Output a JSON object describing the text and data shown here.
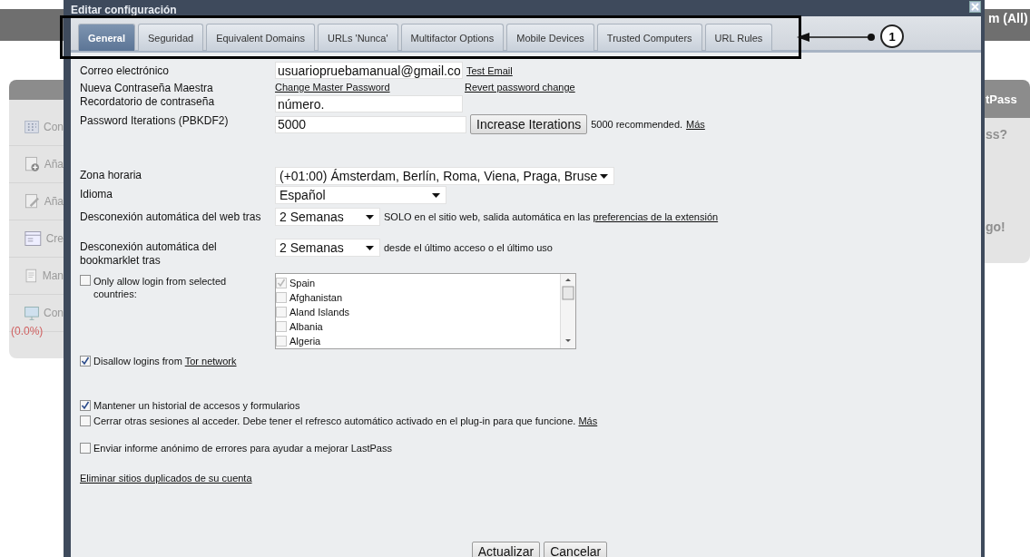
{
  "background": {
    "header_text": "m (All)",
    "sidebar_items": [
      {
        "label": "Con",
        "kind": "grid"
      },
      {
        "label": "Aña",
        "kind": "add"
      },
      {
        "label": "Aña",
        "kind": "edit"
      },
      {
        "label": "Cre",
        "kind": "form"
      },
      {
        "label": "Man",
        "kind": "doc"
      },
      {
        "label": "Con",
        "kind": "screen"
      }
    ],
    "percent": "(0.0%)",
    "right_panel_title": "tPass",
    "right_texts": [
      "ss?",
      "go!"
    ]
  },
  "dialog": {
    "title": "Editar configuración",
    "tabs": [
      {
        "label": "General",
        "selected": true
      },
      {
        "label": "Seguridad",
        "selected": false
      },
      {
        "label": "Equivalent Domains",
        "selected": false
      },
      {
        "label": "URLs 'Nunca'",
        "selected": false
      },
      {
        "label": "Multifactor Options",
        "selected": false
      },
      {
        "label": "Mobile Devices",
        "selected": false
      },
      {
        "label": "Trusted Computers",
        "selected": false
      },
      {
        "label": "URL Rules",
        "selected": false
      }
    ],
    "email": {
      "label": "Correo electrónico",
      "value": "usuariopruebamanual@gmail.co",
      "link": "Test Email"
    },
    "master_password": {
      "label": "Nueva Contraseña Maestra",
      "change_link": "Change Master Password",
      "revert_link": "Revert password change"
    },
    "reminder": {
      "label": "Recordatorio de contraseña",
      "value": "número."
    },
    "iterations": {
      "label": "Password Iterations (PBKDF2)",
      "value": "5000",
      "button": "Increase Iterations",
      "note": "5000 recommended.",
      "link": "Más"
    },
    "timezone": {
      "label": "Zona horaria",
      "value": "(+01:00) Ámsterdam, Berlín, Roma, Viena, Praga, Bruse"
    },
    "language": {
      "label": "Idioma",
      "value": "Español"
    },
    "web_logout": {
      "label": "Desconexión automática del web tras",
      "value": "2 Semanas",
      "note": "SOLO en el sitio web, salida automática en las",
      "link": "preferencias de la extensión"
    },
    "bookmarklet_logout": {
      "label": "Desconexión automática del bookmarklet tras",
      "value": "2 Semanas",
      "note": "desde el último acceso o el último uso"
    },
    "country_restrict": {
      "label": "Only allow login from selected countries:",
      "checked": false
    },
    "countries": [
      {
        "name": "Spain",
        "checked": true
      },
      {
        "name": "Afghanistan",
        "checked": false
      },
      {
        "name": "Aland Islands",
        "checked": false
      },
      {
        "name": "Albania",
        "checked": false
      },
      {
        "name": "Algeria",
        "checked": false
      }
    ],
    "tor": {
      "label": "Disallow logins from",
      "link": "Tor network",
      "checked": true
    },
    "history": {
      "label": "Mantener un historial de accesos y formularios",
      "checked": true
    },
    "close_sessions": {
      "label": "Cerrar otras sesiones al acceder. Debe tener el refresco automático activado en el plug-in para que funcione.",
      "link": "Más",
      "checked": false
    },
    "error_report": {
      "label": "Enviar informe anónimo de errores para ayudar a mejorar LastPass",
      "checked": false
    },
    "remove_duplicates": "Eliminar sitios duplicados de su cuenta",
    "buttons": [
      "Actualizar",
      "Cancelar"
    ]
  },
  "annotation": {
    "label": "1"
  }
}
